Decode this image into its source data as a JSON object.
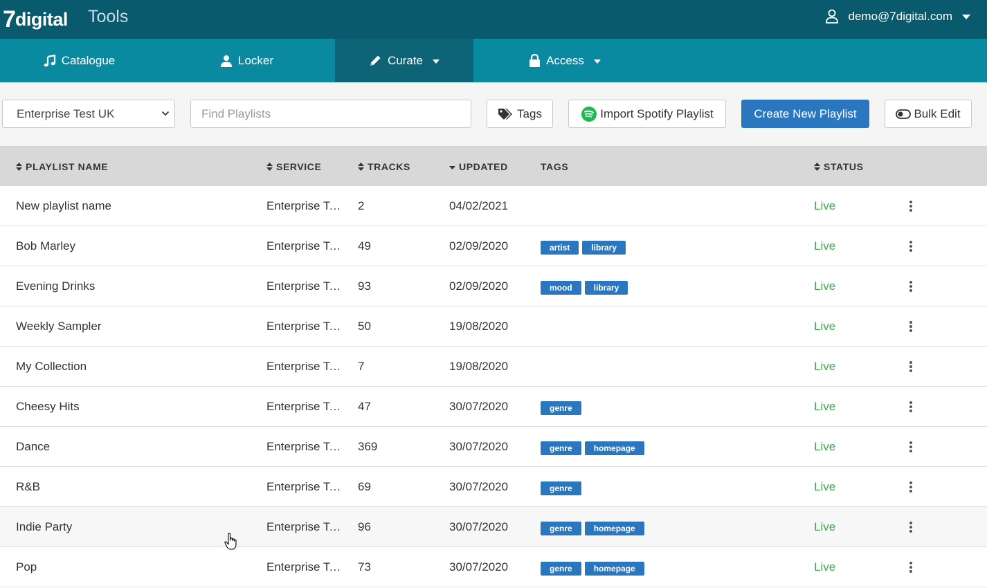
{
  "header": {
    "logo_seven": "7",
    "logo_text": "digital",
    "app_name": "Tools",
    "user_email": "demo@7digital.com"
  },
  "nav": {
    "items": [
      {
        "label": "Catalogue",
        "icon": "music-note-icon",
        "active": false,
        "dropdown": false
      },
      {
        "label": "Locker",
        "icon": "user-icon",
        "active": false,
        "dropdown": false
      },
      {
        "label": "Curate",
        "icon": "pencil-icon",
        "active": true,
        "dropdown": true
      },
      {
        "label": "Access",
        "icon": "lock-icon",
        "active": false,
        "dropdown": true
      }
    ]
  },
  "toolbar": {
    "service_select_value": "Enterprise Test UK",
    "search_placeholder": "Find Playlists",
    "tags_label": "Tags",
    "import_label": "Import Spotify Playlist",
    "create_label": "Create New Playlist",
    "bulk_edit_label": "Bulk Edit"
  },
  "table": {
    "columns": {
      "name": "PLAYLIST NAME",
      "service": "SERVICE",
      "tracks": "TRACKS",
      "updated": "UPDATED",
      "tags": "TAGS",
      "status": "STATUS"
    },
    "rows": [
      {
        "name": "New playlist name",
        "service": "Enterprise Test UK",
        "tracks": "2",
        "updated": "04/02/2021",
        "tags": [],
        "status": "Live"
      },
      {
        "name": "Bob Marley",
        "service": "Enterprise Test UK",
        "tracks": "49",
        "updated": "02/09/2020",
        "tags": [
          "artist",
          "library"
        ],
        "status": "Live"
      },
      {
        "name": "Evening Drinks",
        "service": "Enterprise Test UK",
        "tracks": "93",
        "updated": "02/09/2020",
        "tags": [
          "mood",
          "library"
        ],
        "status": "Live"
      },
      {
        "name": "Weekly Sampler",
        "service": "Enterprise Test UK",
        "tracks": "50",
        "updated": "19/08/2020",
        "tags": [],
        "status": "Live"
      },
      {
        "name": "My Collection",
        "service": "Enterprise Test UK",
        "tracks": "7",
        "updated": "19/08/2020",
        "tags": [],
        "status": "Live"
      },
      {
        "name": "Cheesy Hits",
        "service": "Enterprise Test UK",
        "tracks": "47",
        "updated": "30/07/2020",
        "tags": [
          "genre"
        ],
        "status": "Live"
      },
      {
        "name": "Dance",
        "service": "Enterprise Test UK",
        "tracks": "369",
        "updated": "30/07/2020",
        "tags": [
          "genre",
          "homepage"
        ],
        "status": "Live"
      },
      {
        "name": "R&B",
        "service": "Enterprise Test UK",
        "tracks": "69",
        "updated": "30/07/2020",
        "tags": [
          "genre"
        ],
        "status": "Live"
      },
      {
        "name": "Indie Party",
        "service": "Enterprise Test UK",
        "tracks": "96",
        "updated": "30/07/2020",
        "tags": [
          "genre",
          "homepage"
        ],
        "status": "Live"
      },
      {
        "name": "Pop",
        "service": "Enterprise Test UK",
        "tracks": "73",
        "updated": "30/07/2020",
        "tags": [
          "genre",
          "homepage"
        ],
        "status": "Live"
      }
    ]
  },
  "colors": {
    "header_bg": "#085a6c",
    "nav_bg": "#0a8aa1",
    "nav_active_bg": "#0d6477",
    "primary_button": "#2a77c0",
    "tag_bg": "#2a77c0",
    "status_live": "#3fa84a",
    "spotify_green": "#1db954"
  }
}
